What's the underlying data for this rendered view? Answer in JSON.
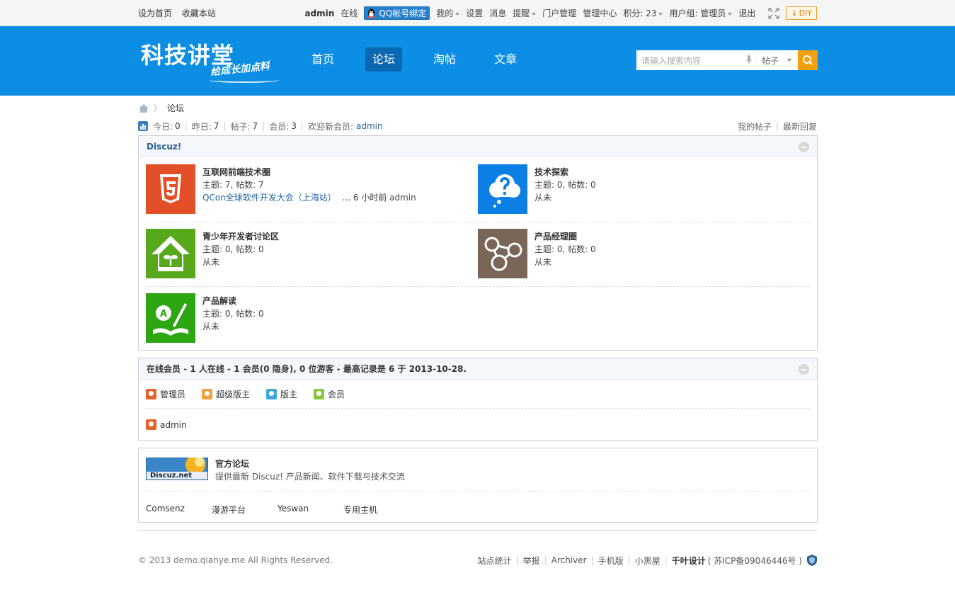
{
  "topbar": {
    "set_home": "设为首页",
    "bookmark": "收藏本站",
    "username": "admin",
    "online": "在线",
    "qq_bind": "QQ帐号绑定",
    "mine": "我的",
    "settings": "设置",
    "messages": "消息",
    "reminders": "提醒",
    "portal_manage": "门户管理",
    "admin_center": "管理中心",
    "credits": "积分: 23",
    "usergroup": "用户组: 管理员",
    "logout": "退出",
    "diy": "DIY"
  },
  "header": {
    "logo_main": "科技讲堂",
    "logo_slogan": "给成长加点料",
    "nav": [
      {
        "label": "首页",
        "active": false
      },
      {
        "label": "论坛",
        "active": true
      },
      {
        "label": "淘帖",
        "active": false
      },
      {
        "label": "文章",
        "active": false
      }
    ],
    "search": {
      "placeholder": "请输入搜索内容",
      "type": "帖子"
    }
  },
  "breadcrumb": {
    "current": "论坛"
  },
  "stats": {
    "today_label": "今日:",
    "today": "0",
    "yesterday_label": "昨日:",
    "yesterday": "7",
    "posts_label": "帖子:",
    "posts": "7",
    "members_label": "会员:",
    "members": "3",
    "welcome_label": "欢迎新会员:",
    "newest_member": "admin",
    "my_posts": "我的帖子",
    "latest_replies": "最新回复"
  },
  "category": {
    "title": "Discuz!",
    "forums": [
      {
        "name": "互联网前端技术圈",
        "stats": "主题: 7, 帖数: 7",
        "last_title": "QCon全球软件开发大会（上海站）",
        "last_meta": "... 6 小时前 admin",
        "icon": "html5-icon",
        "color": "#e34f26"
      },
      {
        "name": "技术探索",
        "stats": "主题: 0, 帖数: 0",
        "last_meta": "从未",
        "icon": "question-cloud-icon",
        "color": "#0b7fe3"
      },
      {
        "name": "青少年开发者讨论区",
        "stats": "主题: 0, 帖数: 0",
        "last_meta": "从未",
        "icon": "house-sprout-icon",
        "color": "#58a81c"
      },
      {
        "name": "产品经理圈",
        "stats": "主题: 0, 帖数: 0",
        "last_meta": "从未",
        "icon": "share-nodes-icon",
        "color": "#7a6659"
      },
      {
        "name": "产品解读",
        "stats": "主题: 0, 帖数: 0",
        "last_meta": "从未",
        "icon": "book-pen-icon",
        "color": "#2ea612"
      }
    ]
  },
  "online": {
    "title": "在线会员 - 1 人在线 - 1 会员(0 隐身), 0 位游客 - 最高记录是 6 于 2013-10-28.",
    "legend": [
      {
        "label": "管理员",
        "color": "#e8602c"
      },
      {
        "label": "超级版主",
        "color": "#f0a040"
      },
      {
        "label": "版主",
        "color": "#3ea6e0"
      },
      {
        "label": "会员",
        "color": "#8cc63f"
      }
    ],
    "users": [
      {
        "name": "admin",
        "color": "#e8602c"
      }
    ]
  },
  "links": {
    "featured": {
      "logo_text": "Discuz.net",
      "name": "官方论坛",
      "desc": "提供最新 Discuz! 产品新闻、软件下载与技术交流"
    },
    "text_links": [
      "Comsenz",
      "漫游平台",
      "Yeswan",
      "专用主机"
    ]
  },
  "footer": {
    "copyright": "© 2013 demo.qianye.me All Rights Reserved.",
    "links": [
      "站点统计",
      "举报",
      "Archiver",
      "手机版",
      "小黑屋"
    ],
    "designer": "千叶设计",
    "icp": "( 苏ICP备09046446号 )"
  }
}
